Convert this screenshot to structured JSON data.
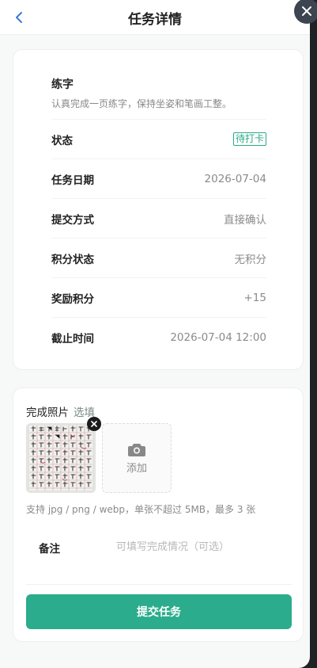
{
  "header": {
    "title": "任务详情"
  },
  "task": {
    "name": "练字",
    "description": "认真完成一页练字，保持坐姿和笔画工整。"
  },
  "details": [
    {
      "label": "状态",
      "value": "待打卡",
      "type": "badge",
      "color": "#2aa987"
    },
    {
      "label": "任务日期",
      "value": "2026-07-04"
    },
    {
      "label": "提交方式",
      "value": "直接确认"
    },
    {
      "label": "积分状态",
      "value": "无积分"
    },
    {
      "label": "奖励积分",
      "value": "+15"
    },
    {
      "label": "截止时间",
      "value": "2026-07-04 12:00"
    }
  ],
  "upload": {
    "title": "完成照片",
    "optional_tag": "选填",
    "add_label": "添加",
    "hint": "支持 jpg / png / webp，单张不超过 5MB，最多 3 张"
  },
  "note": {
    "label": "备注",
    "placeholder": "可填写完成情况（可选）"
  },
  "submit": {
    "label": "提交任务"
  },
  "colors": {
    "accent": "#2bac8c",
    "back_arrow": "#3a7bd5"
  }
}
